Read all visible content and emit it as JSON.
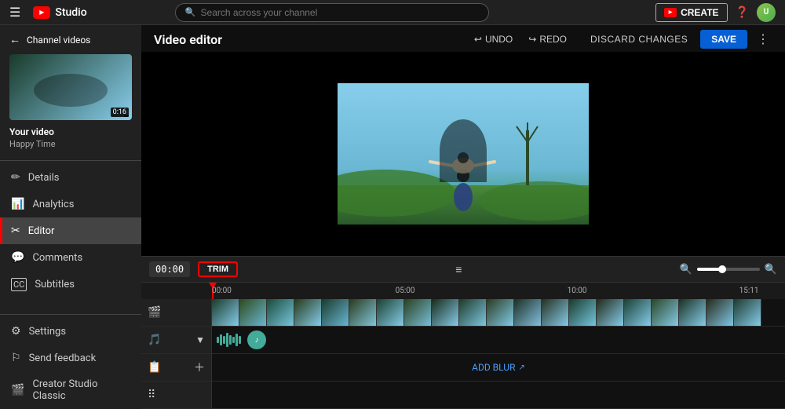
{
  "topbar": {
    "menu_icon": "☰",
    "logo_text": "Studio",
    "search_placeholder": "Search across your channel",
    "create_label": "CREATE",
    "help_icon": "?",
    "avatar_text": "U"
  },
  "sidebar": {
    "back_label": "Channel videos",
    "video_title": "Your video",
    "video_subtitle": "Happy Time",
    "video_duration": "0:16",
    "items": [
      {
        "id": "details",
        "label": "Details",
        "icon": "✏️"
      },
      {
        "id": "analytics",
        "label": "Analytics",
        "icon": "📊"
      },
      {
        "id": "editor",
        "label": "Editor",
        "icon": "✂️",
        "active": true
      },
      {
        "id": "comments",
        "label": "Comments",
        "icon": "💬"
      },
      {
        "id": "subtitles",
        "label": "Subtitles",
        "icon": "CC"
      }
    ],
    "settings_label": "Settings",
    "feedback_label": "Send feedback",
    "classic_label": "Creator Studio Classic"
  },
  "editor": {
    "title": "Video editor",
    "undo_label": "UNDO",
    "redo_label": "REDO",
    "discard_label": "DISCARD CHANGES",
    "save_label": "SAVE"
  },
  "timeline": {
    "time_display": "00:00",
    "trim_label": "TRIM",
    "markers": [
      "00:00",
      "05:00",
      "10:00",
      "15:11"
    ],
    "add_blur_label": "ADD BLUR",
    "track_count": 20
  }
}
